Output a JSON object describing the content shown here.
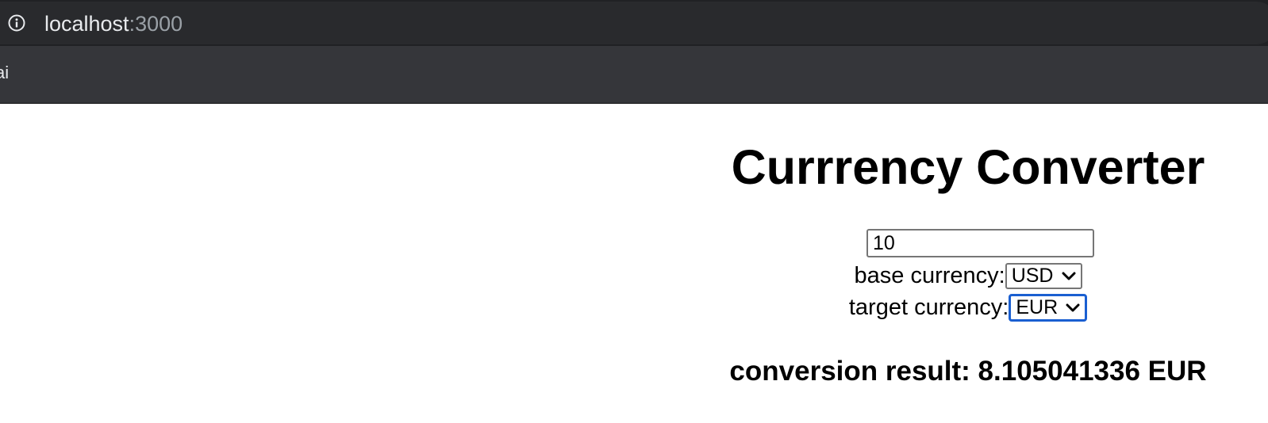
{
  "browser": {
    "url_host": "localhost",
    "url_port": ":3000",
    "bookmarks": [
      {
        "label": "ai"
      }
    ]
  },
  "page": {
    "title": "Currrency Converter",
    "amount": {
      "value": "10"
    },
    "base_currency": {
      "label": "base currency:",
      "selected": "USD"
    },
    "target_currency": {
      "label": "target currency:",
      "selected": "EUR"
    },
    "result": "conversion result: 8.105041336 EUR"
  },
  "colors": {
    "chrome_dark": "#202124",
    "bookmarks_bar": "#35363a",
    "focus_ring": "#1a5fd1"
  },
  "icons": {
    "site_info": "info-icon",
    "select_arrow": "chevron-down-icon"
  }
}
